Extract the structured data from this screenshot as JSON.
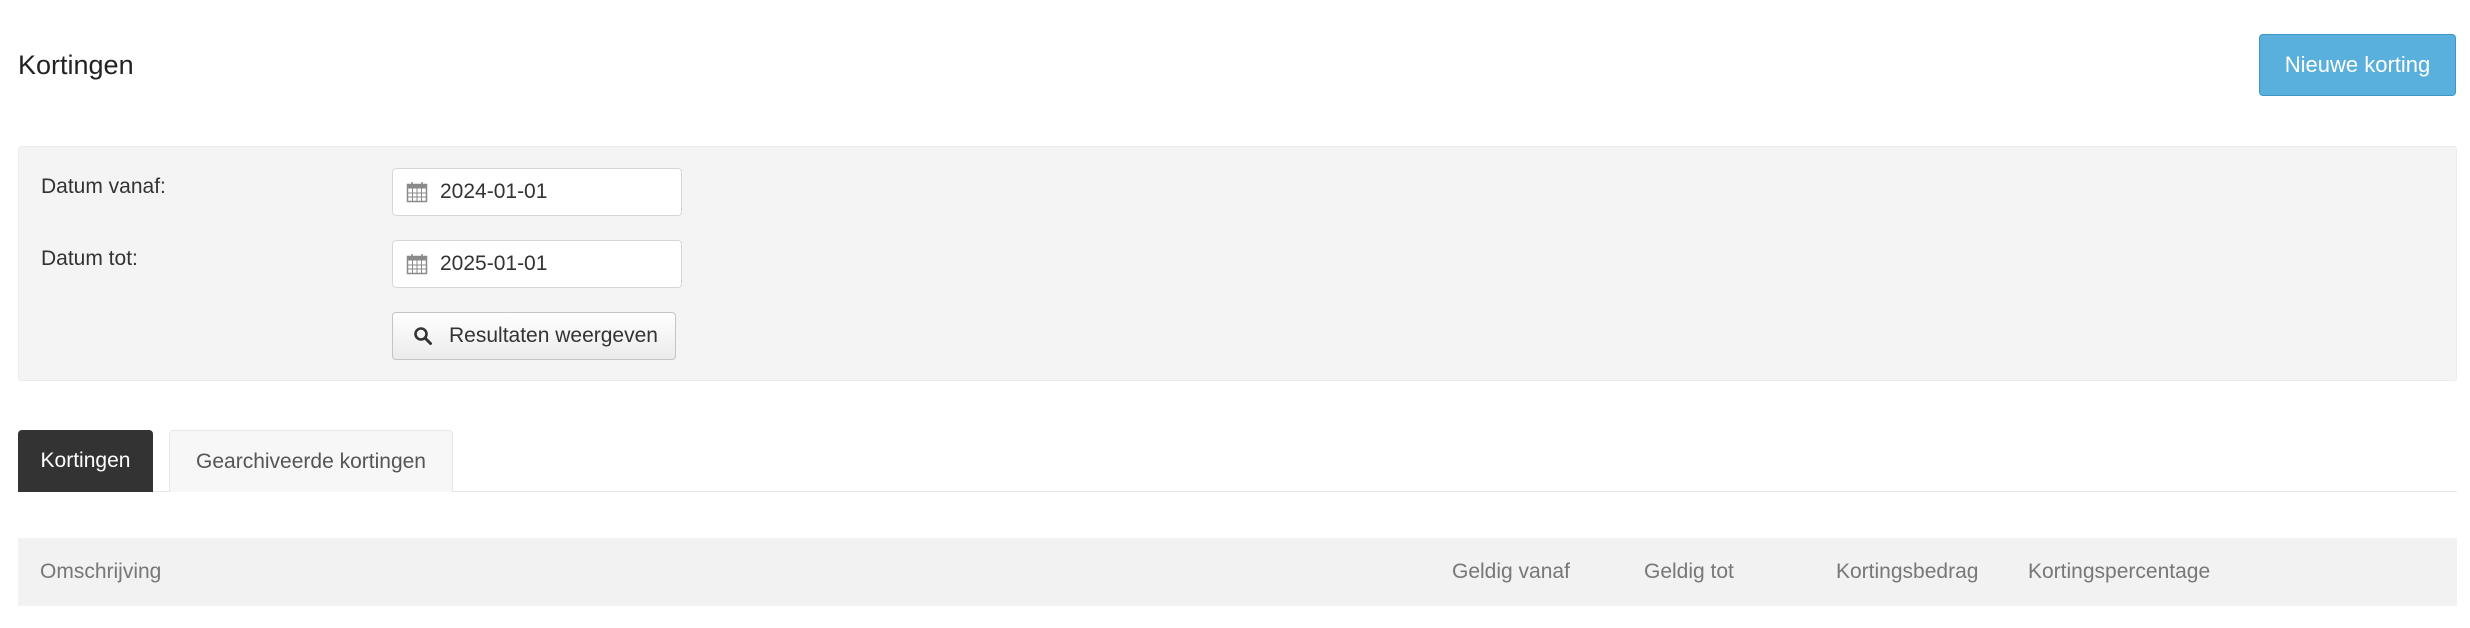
{
  "header": {
    "title": "Kortingen",
    "new_button_label": "Nieuwe korting"
  },
  "filter": {
    "date_from_label": "Datum vanaf:",
    "date_from_value": "2024-01-01",
    "date_to_label": "Datum tot:",
    "date_to_value": "2025-01-01",
    "search_button_label": "Resultaten weergeven"
  },
  "tabs": [
    {
      "label": "Kortingen",
      "active": true
    },
    {
      "label": "Gearchiveerde kortingen",
      "active": false
    }
  ],
  "table": {
    "columns": [
      "Omschrijving",
      "Geldig vanaf",
      "Geldig tot",
      "Kortingsbedrag",
      "Kortingspercentage"
    ],
    "rows": []
  },
  "colors": {
    "primary_button": "#5ab0dc",
    "active_tab": "#333333",
    "panel_background": "#f4f4f4"
  },
  "icons": {
    "date_icon": "calendar-icon",
    "search_icon": "search-icon"
  }
}
